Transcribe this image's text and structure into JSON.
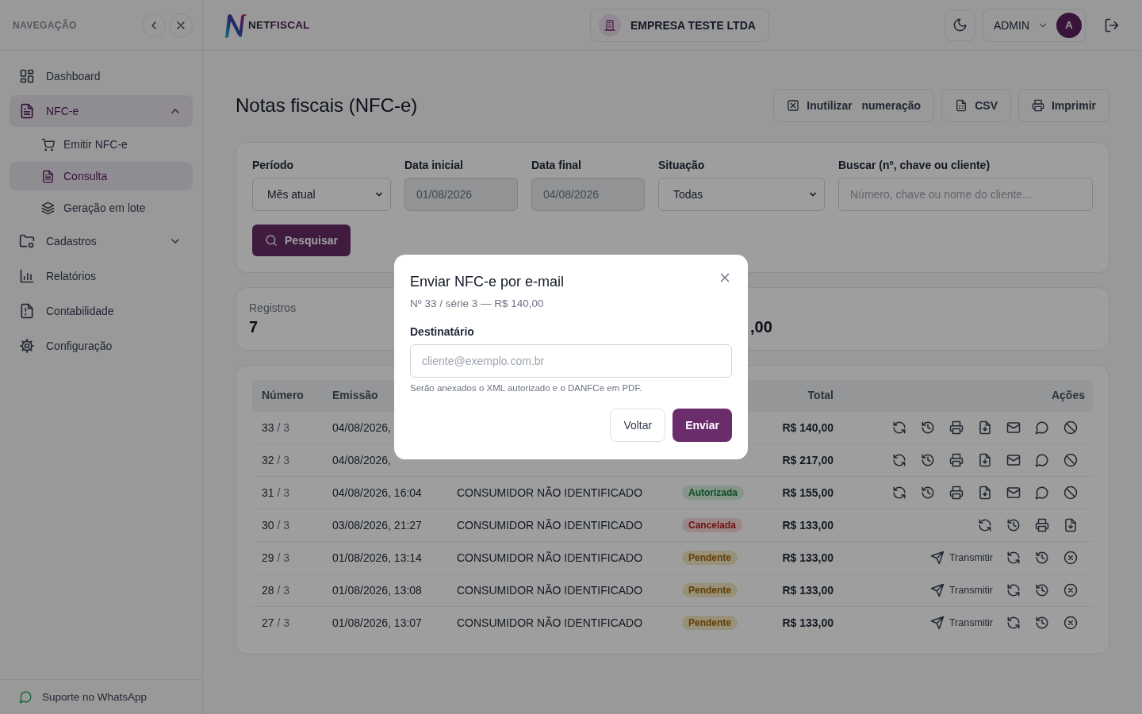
{
  "sidebar": {
    "title": "NAVEGAÇÃO",
    "items": [
      {
        "kind": "grid",
        "label": "Dashboard",
        "selected": false
      },
      {
        "kind": "file",
        "label": "NFC-e",
        "selected": true,
        "expanded": true,
        "children": [
          {
            "kind": "cart",
            "label": "Emitir NFC-e",
            "selected": false
          },
          {
            "kind": "file",
            "label": "Consulta",
            "selected": true
          },
          {
            "kind": "layers",
            "label": "Geração em lote",
            "selected": false
          }
        ]
      },
      {
        "kind": "folder",
        "label": "Cadastros",
        "selected": false,
        "expanded": false
      },
      {
        "kind": "chart",
        "label": "Relatórios",
        "selected": false
      },
      {
        "kind": "doc",
        "label": "Contabilidade",
        "selected": false
      },
      {
        "kind": "gear",
        "label": "Configuração",
        "selected": false
      }
    ],
    "footer": "Suporte no WhatsApp"
  },
  "header": {
    "logo": {
      "prefix": "NET",
      "suffix": "FISCAL"
    },
    "company": "EMPRESA TESTE LTDA",
    "user": "ADMIN",
    "avatar": "A"
  },
  "page": {
    "title": "Notas fiscais (NFC-e)",
    "buttons": [
      {
        "kind": "void",
        "label": "Inutilizar   numeração"
      },
      {
        "kind": "csv",
        "label": "CSV"
      },
      {
        "kind": "print",
        "label": "Imprimir"
      }
    ]
  },
  "filters": [
    {
      "kind": "select",
      "label": "Período",
      "value": "Mês atual",
      "disabled": false
    },
    {
      "kind": "date",
      "label": "Data inicial",
      "value": "01/08/2026",
      "disabled": true
    },
    {
      "kind": "date",
      "label": "Data final",
      "value": "04/08/2026",
      "disabled": true
    },
    {
      "kind": "select",
      "label": "Situação",
      "value": "Todas",
      "disabled": false
    },
    {
      "kind": "text",
      "label": "Buscar (nº, chave ou cliente)",
      "placeholder": "Número, chave ou nome do cliente..."
    }
  ],
  "search_button": "Pesquisar",
  "stats": [
    {
      "label": "Registros",
      "value": "7"
    },
    {
      "value": ",00"
    }
  ],
  "table": {
    "columns": [
      "Número",
      "Emissão",
      null,
      null,
      "Total",
      "Ações"
    ],
    "rows": [
      {
        "number": "33",
        "series": "/ 3",
        "issued": "04/08/2026,",
        "total": "R$ 140,00",
        "actions": [
          {
            "kind": "sync"
          },
          {
            "kind": "history"
          },
          {
            "kind": "print"
          },
          {
            "kind": "download"
          },
          {
            "kind": "mail"
          },
          {
            "kind": "chat"
          },
          {
            "kind": "ban"
          }
        ]
      },
      {
        "number": "32",
        "series": "/ 3",
        "issued": "04/08/2026,",
        "total": "R$ 217,00",
        "actions": [
          {
            "kind": "sync"
          },
          {
            "kind": "history"
          },
          {
            "kind": "print"
          },
          {
            "kind": "download"
          },
          {
            "kind": "mail"
          },
          {
            "kind": "chat"
          },
          {
            "kind": "ban"
          }
        ]
      },
      {
        "number": "31",
        "series": "/ 3",
        "issued": "04/08/2026, 16:04",
        "client": "CONSUMIDOR NÃO IDENTIFICADO",
        "status": {
          "label": "Autorizada",
          "kind": "authorized"
        },
        "total": "R$ 155,00",
        "actions": [
          {
            "kind": "sync"
          },
          {
            "kind": "history"
          },
          {
            "kind": "print"
          },
          {
            "kind": "download"
          },
          {
            "kind": "mail"
          },
          {
            "kind": "chat"
          },
          {
            "kind": "ban"
          }
        ]
      },
      {
        "number": "30",
        "series": "/ 3",
        "issued": "03/08/2026, 21:27",
        "client": "CONSUMIDOR NÃO IDENTIFICADO",
        "status": {
          "label": "Cancelada",
          "kind": "cancelled"
        },
        "total": "R$ 133,00",
        "actions": [
          {
            "kind": "sync"
          },
          {
            "kind": "history"
          },
          {
            "kind": "print"
          },
          {
            "kind": "download"
          }
        ]
      },
      {
        "number": "29",
        "series": "/ 3",
        "issued": "01/08/2026, 13:14",
        "client": "CONSUMIDOR NÃO IDENTIFICADO",
        "status": {
          "label": "Pendente",
          "kind": "pending"
        },
        "total": "R$ 133,00",
        "actions": [
          {
            "kind": "transmit",
            "label": "Transmitir"
          },
          {
            "kind": "sync"
          },
          {
            "kind": "history"
          },
          {
            "kind": "discard"
          }
        ]
      },
      {
        "number": "28",
        "series": "/ 3",
        "issued": "01/08/2026, 13:08",
        "client": "CONSUMIDOR NÃO IDENTIFICADO",
        "status": {
          "label": "Pendente",
          "kind": "pending"
        },
        "total": "R$ 133,00",
        "actions": [
          {
            "kind": "transmit",
            "label": "Transmitir"
          },
          {
            "kind": "sync"
          },
          {
            "kind": "history"
          },
          {
            "kind": "discard"
          }
        ]
      },
      {
        "number": "27",
        "series": "/ 3",
        "issued": "01/08/2026, 13:07",
        "client": "CONSUMIDOR NÃO IDENTIFICADO",
        "status": {
          "label": "Pendente",
          "kind": "pending"
        },
        "total": "R$ 133,00",
        "actions": [
          {
            "kind": "transmit",
            "label": "Transmitir"
          },
          {
            "kind": "sync"
          },
          {
            "kind": "history"
          },
          {
            "kind": "discard"
          }
        ]
      }
    ]
  },
  "modal": {
    "title": "Enviar NFC-e por e-mail",
    "subtitle": "Nº 33 / série 3 — R$ 140,00",
    "field_label": "Destinatário",
    "placeholder": "cliente@exemplo.com.br",
    "hint": "Serão anexados o XML autorizado e o DANFCe em PDF.",
    "buttons": [
      {
        "kind": "secondary",
        "label": "Voltar"
      },
      {
        "kind": "primary",
        "label": "Enviar"
      }
    ]
  }
}
